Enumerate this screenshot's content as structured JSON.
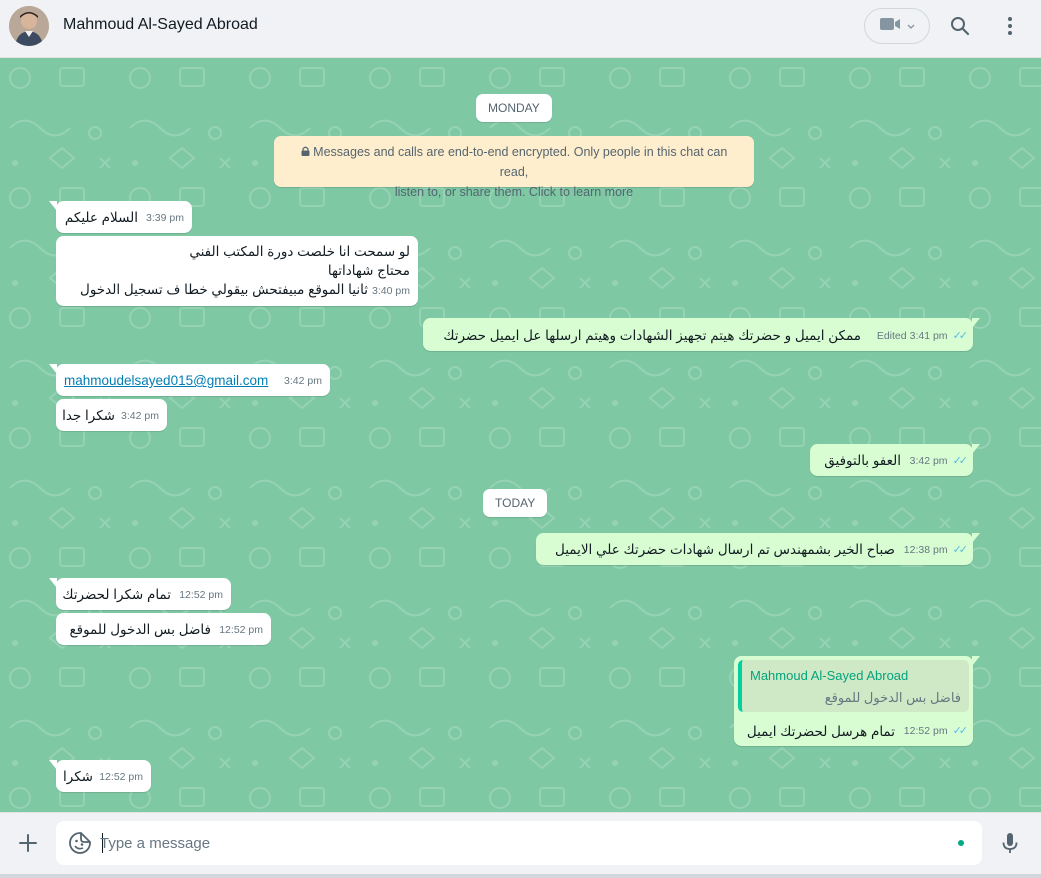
{
  "header": {
    "contact_name": "Mahmoud Al-Sayed Abroad",
    "icons": [
      "video-call-icon",
      "chevron-down-icon",
      "search-icon",
      "menu-icon"
    ]
  },
  "chat": {
    "day_monday": "MONDAY",
    "day_today": "TODAY",
    "encryption_line1": "Messages and calls are end-to-end encrypted. Only people in this chat can read,",
    "encryption_line2": "listen to, or share them. Click to learn more",
    "messages": [
      {
        "dir": "in",
        "text": "السلام عليكم",
        "time": "3:39 pm"
      },
      {
        "dir": "in",
        "line1": "لو سمحت انا خلصت دورة المكتب الفني",
        "line2": "محتاج شهاداتها",
        "line3": "ثانيا الموقع مبيفتحش بيقولي خطا ف تسجيل الدخول",
        "time": "3:40 pm"
      },
      {
        "dir": "out",
        "text": "ممكن ايميل و حضرتك هيتم تجهيز الشهادات وهيتم ارسلها عل ايميل حضرتك",
        "edited": "Edited",
        "time": "3:41 pm"
      },
      {
        "dir": "in",
        "text": "mahmoudelsayed015@gmail.com",
        "time": "3:42 pm"
      },
      {
        "dir": "in",
        "text": "شكرا جدا",
        "time": "3:42 pm"
      },
      {
        "dir": "out",
        "text": "العفو بالتوفيق",
        "time": "3:42 pm"
      },
      {
        "dir": "out",
        "text": "صباح الخير بشمهندس تم ارسال شهادات حضرتك علي الايميل",
        "time": "12:38 pm"
      },
      {
        "dir": "in",
        "text": "تمام شكرا لحضرتك",
        "time": "12:52 pm"
      },
      {
        "dir": "in",
        "text": "فاضل بس الدخول للموقع",
        "time": "12:52 pm"
      },
      {
        "dir": "out",
        "quote_name": "Mahmoud Al-Sayed Abroad",
        "quote_text": "فاضل بس الدخول للموقع",
        "text": "تمام هرسل لحضرتك ايميل",
        "time": "12:52 pm"
      },
      {
        "dir": "in",
        "text": "شكرا",
        "time": "12:52 pm"
      }
    ]
  },
  "composer": {
    "placeholder": "Type a message",
    "icons": [
      "plus-icon",
      "sticker-icon",
      "microphone-icon"
    ]
  },
  "colors": {
    "chat_background": "#7fc8a4",
    "outgoing_bubble": "#d9fdd3",
    "incoming_bubble": "#ffffff",
    "encryption_note": "#ffeecd",
    "read_ticks": "#53bdeb",
    "accent": "#00a884"
  }
}
